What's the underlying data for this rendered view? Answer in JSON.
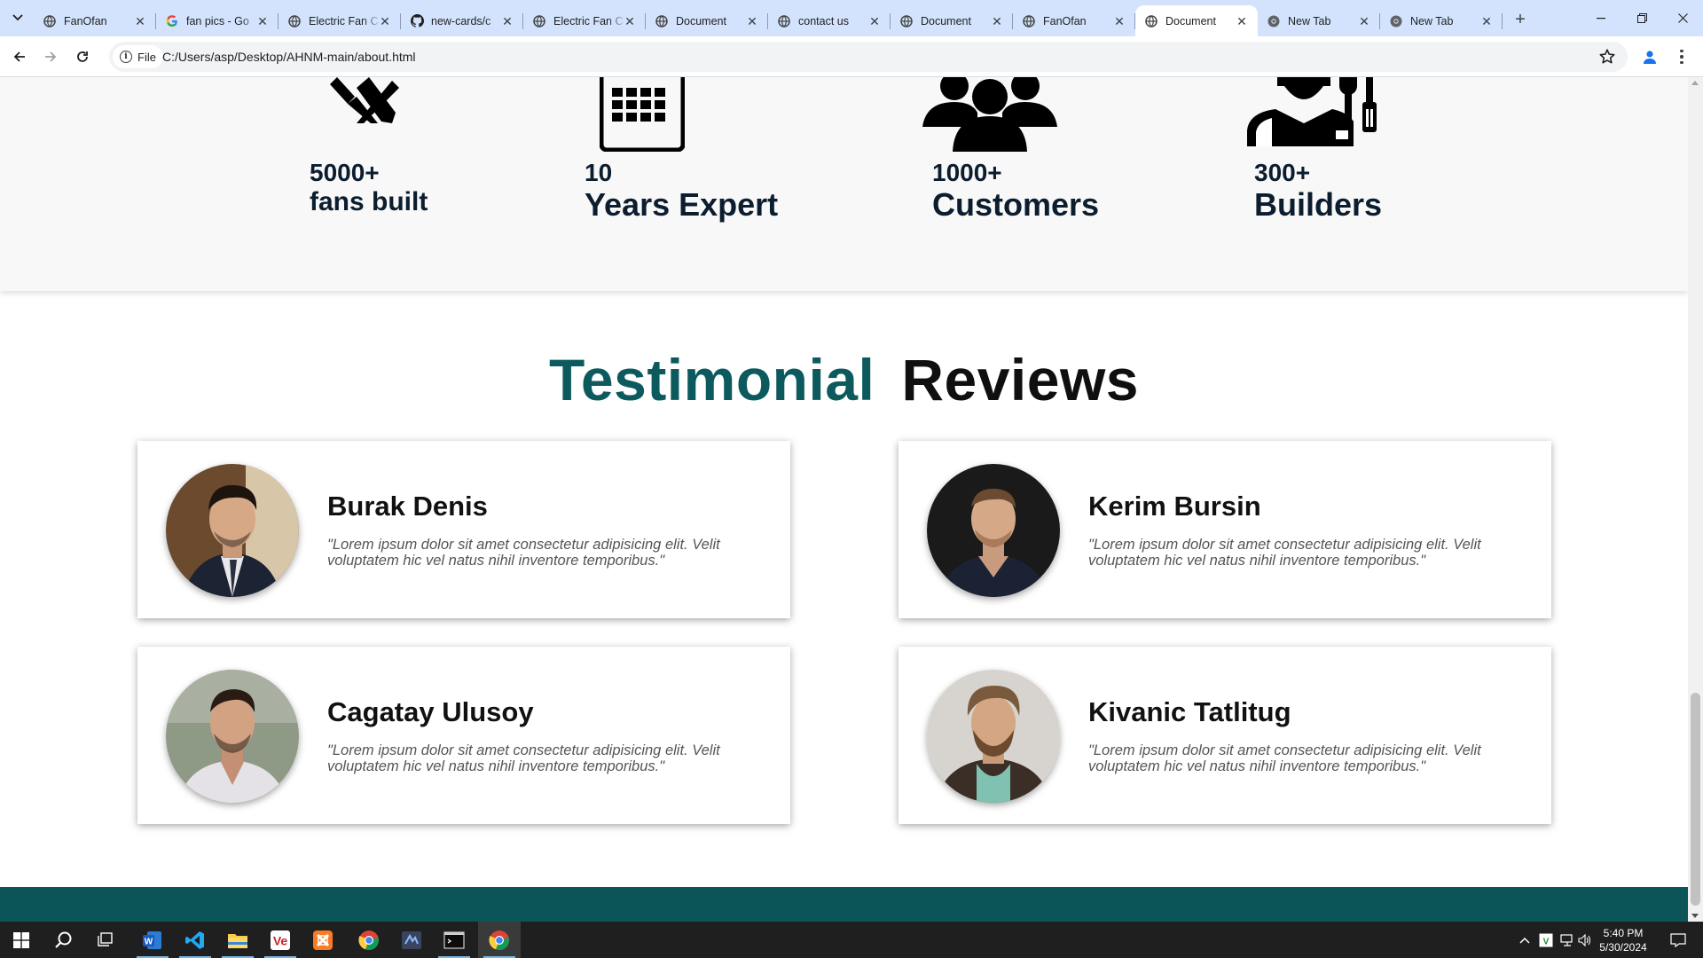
{
  "browser": {
    "tabs": [
      {
        "title": "FanOfan",
        "icon": "globe-icon"
      },
      {
        "title": "fan pics - Go",
        "icon": "google-icon"
      },
      {
        "title": "Electric Fan C",
        "icon": "globe-icon"
      },
      {
        "title": "new-cards/c",
        "icon": "github-icon"
      },
      {
        "title": "Electric Fan C",
        "icon": "globe-icon"
      },
      {
        "title": "Document",
        "icon": "globe-icon"
      },
      {
        "title": "contact us",
        "icon": "globe-icon"
      },
      {
        "title": "Document",
        "icon": "globe-icon"
      },
      {
        "title": "FanOfan",
        "icon": "globe-icon"
      },
      {
        "title": "Document",
        "icon": "globe-icon",
        "active": true
      },
      {
        "title": "New Tab",
        "icon": "chrome-icon"
      },
      {
        "title": "New Tab",
        "icon": "chrome-icon"
      }
    ],
    "site_chip": "File",
    "url": "C:/Users/asp/Desktop/AHNM-main/about.html"
  },
  "page": {
    "stats": [
      {
        "number": "5000+",
        "label": "fans built",
        "icon": "tools-icon"
      },
      {
        "number": "10",
        "label": "Years Expert",
        "icon": "calendar-icon"
      },
      {
        "number": "1000+",
        "label": "Customers",
        "icon": "users-icon"
      },
      {
        "number": "300+",
        "label": "Builders",
        "icon": "worker-icon"
      }
    ],
    "heading": {
      "part1": "Testimonial",
      "part2": "Reviews"
    },
    "testimonials": [
      {
        "name": "Burak Denis",
        "quote": "\"Lorem ipsum dolor sit amet consectetur adipisicing elit. Velit voluptatem hic vel natus nihil inventore temporibus.\""
      },
      {
        "name": "Kerim Bursin",
        "quote": "\"Lorem ipsum dolor sit amet consectetur adipisicing elit. Velit voluptatem hic vel natus nihil inventore temporibus.\""
      },
      {
        "name": "Cagatay Ulusoy",
        "quote": "\"Lorem ipsum dolor sit amet consectetur adipisicing elit. Velit voluptatem hic vel natus nihil inventore temporibus.\""
      },
      {
        "name": "Kivanic Tatlitug",
        "quote": "\"Lorem ipsum dolor sit amet consectetur adipisicing elit. Velit voluptatem hic vel natus nihil inventore temporibus.\""
      }
    ]
  },
  "taskbar": {
    "apps": [
      "windows-start-icon",
      "search-icon",
      "task-view-icon",
      "word-icon",
      "vscode-icon",
      "file-explorer-icon",
      "v-app-icon",
      "xampp-icon",
      "chrome-icon",
      "code-editor-icon",
      "terminal-icon",
      "chrome-active-icon"
    ],
    "time": "5:40 PM",
    "date": "5/30/2024"
  },
  "colors": {
    "accent_teal": "#0c5a5d",
    "footer_teal": "#0b5458",
    "text_dark": "#0b1d2e",
    "tabstrip_bg": "#d3e3fd"
  }
}
